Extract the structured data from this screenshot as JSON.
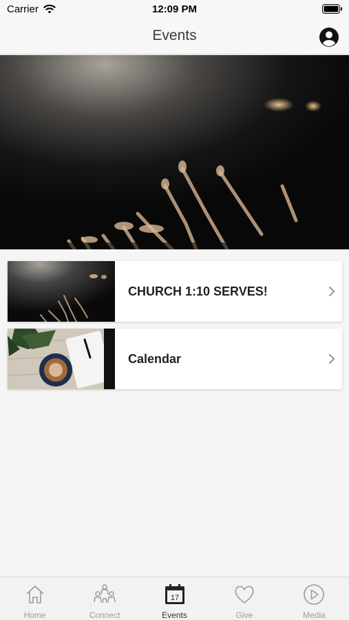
{
  "status_bar": {
    "carrier": "Carrier",
    "time": "12:09 PM"
  },
  "nav": {
    "title": "Events"
  },
  "events": [
    {
      "title": "CHURCH 1:10 SERVES!"
    },
    {
      "title": "Calendar"
    }
  ],
  "tab_bar": {
    "tabs": [
      {
        "label": "Home",
        "icon": "home-icon"
      },
      {
        "label": "Connect",
        "icon": "people-icon"
      },
      {
        "label": "Events",
        "icon": "calendar-icon",
        "active": true
      },
      {
        "label": "Give",
        "icon": "heart-icon"
      },
      {
        "label": "Media",
        "icon": "play-icon"
      }
    ],
    "calendar_day": "17"
  },
  "colors": {
    "active_tab": "#333333",
    "inactive_tab": "#9a9a9a",
    "background": "#f5f5f5"
  }
}
